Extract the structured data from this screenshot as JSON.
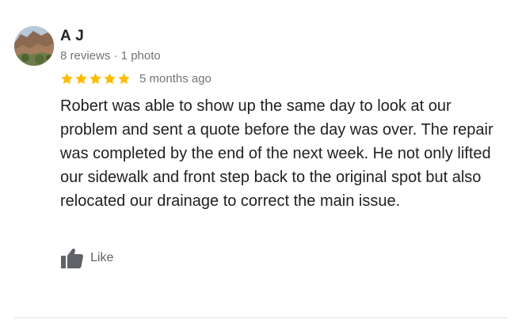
{
  "review": {
    "reviewer_name": "A J",
    "reviewer_meta": "8 reviews · 1 photo",
    "rating": 5,
    "rating_max": 5,
    "time_ago": "5 months ago",
    "text": "Robert was able to show up the same day to look at our problem and sent a quote before the day was over. The repair was completed by the end of the next week. He not only lifted our sidewalk and front step back to the original spot but also relocated our drainage to correct the main issue.",
    "like_label": "Like",
    "avatar_icon": "profile-photo-landscape",
    "star_icon": "star-icon",
    "like_icon": "thumbs-up-icon"
  },
  "colors": {
    "star": "#fbbc04",
    "text": "#202124",
    "meta": "#70757a",
    "like_icon": "#5f6368",
    "divider": "#e0e0e0"
  }
}
